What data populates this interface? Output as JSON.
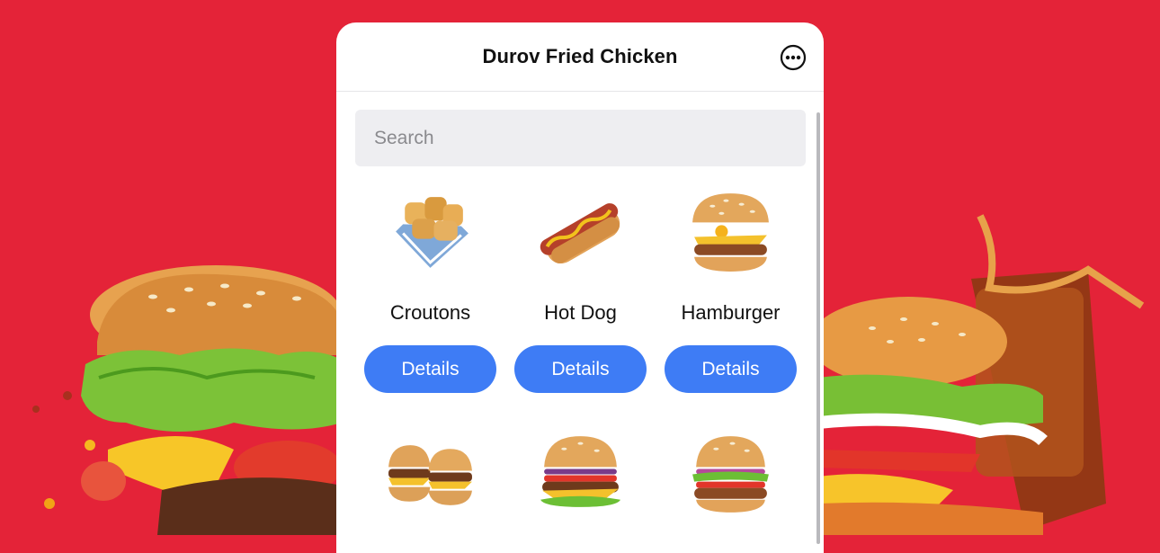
{
  "app": {
    "title": "Durov Fried Chicken",
    "more_icon": "more-horizontal-circle-icon"
  },
  "search": {
    "placeholder": "Search",
    "value": ""
  },
  "items": [
    {
      "name": "Croutons",
      "button": "Details",
      "icon": "croutons-basket-icon"
    },
    {
      "name": "Hot Dog",
      "button": "Details",
      "icon": "hot-dog-icon"
    },
    {
      "name": "Hamburger",
      "button": "Details",
      "icon": "hamburger-egg-icon"
    },
    {
      "name": "",
      "button": "",
      "icon": "double-cheeseburger-icon"
    },
    {
      "name": "",
      "button": "",
      "icon": "cheeseburger-icon"
    },
    {
      "name": "",
      "button": "",
      "icon": "veggie-burger-icon"
    }
  ],
  "colors": {
    "background": "#e42338",
    "accent": "#3e7cf5",
    "search_bg": "#eeeef1"
  }
}
